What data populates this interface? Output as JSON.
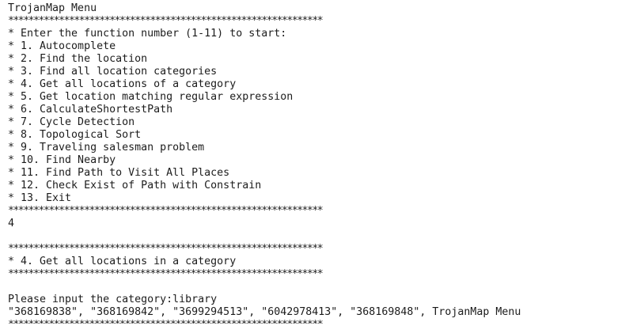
{
  "terminal": {
    "title": "TrojanMap Menu",
    "separator": "**************************************************************",
    "prompt": "* Enter the function number (1-11) to start:",
    "menu_items": [
      "* 1. Autocomplete",
      "* 2. Find the location",
      "* 3. Find all location categories",
      "* 4. Get all locations of a category",
      "* 5. Get location matching regular expression",
      "* 6. CalculateShortestPath",
      "* 7. Cycle Detection",
      "* 8. Topological Sort",
      "* 9. Traveling salesman problem",
      "* 10. Find Nearby",
      "* 11. Find Path to Visit All Places",
      "* 12. Check Exist of Path with Constrain",
      "* 13. Exit"
    ],
    "user_input": "4",
    "section_header": "* 4. Get all locations in a category",
    "category_prompt": "Please input the category:library",
    "result_line": "\"368169838\", \"368169842\", \"3699294513\", \"6042978413\", \"368169848\", TrojanMap Menu"
  }
}
